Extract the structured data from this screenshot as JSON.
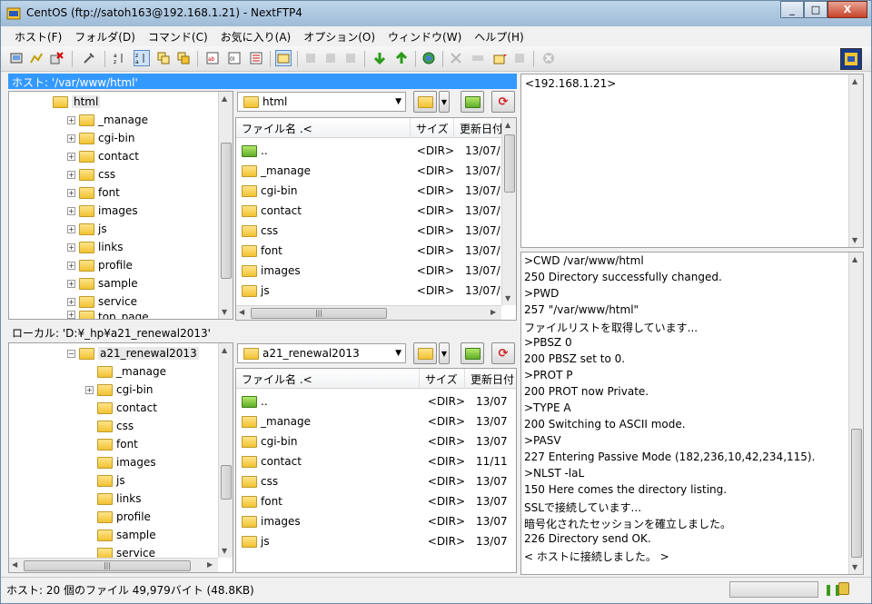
{
  "window": {
    "title": "CentOS (ftp://satoh163@192.168.1.21) - NextFTP4",
    "minimize": "_",
    "maximize": "□",
    "close": "X"
  },
  "menu": [
    "ホスト(F)",
    "フォルダ(D)",
    "コマンド(C)",
    "お気に入り(A)",
    "オプション(O)",
    "ウィンドウ(W)",
    "ヘルプ(H)"
  ],
  "toolbar": {
    "icons": [
      "connect-icon",
      "quick-connect-icon",
      "disconnect-icon",
      "properties-icon",
      "sort-asc-icon",
      "sort-desc-icon",
      "copy-view-icon",
      "sync-icon",
      "view-large-icon",
      "view-list-icon",
      "view-detail-icon",
      "open-folder-icon",
      "cut-icon",
      "copy-icon",
      "paste-icon",
      "download-icon",
      "upload-icon",
      "web-icon",
      "delete-icon",
      "rename-icon",
      "new-folder-icon",
      "attributes-icon",
      "stop-icon"
    ]
  },
  "remote": {
    "path_label": "ホスト: '/var/www/html'",
    "tree_root": "html",
    "tree_items": [
      "_manage",
      "cgi-bin",
      "contact",
      "css",
      "font",
      "images",
      "js",
      "links",
      "profile",
      "sample",
      "service",
      "top_page"
    ],
    "combo_value": "html",
    "columns": [
      "ファイル名 .<",
      "サイズ",
      "更新日付"
    ],
    "files": [
      {
        "name": "..",
        "size": "<DIR>",
        "date": "13/07/"
      },
      {
        "name": "_manage",
        "size": "<DIR>",
        "date": "13/07/"
      },
      {
        "name": "cgi-bin",
        "size": "<DIR>",
        "date": "13/07/"
      },
      {
        "name": "contact",
        "size": "<DIR>",
        "date": "13/07/"
      },
      {
        "name": "css",
        "size": "<DIR>",
        "date": "13/07/"
      },
      {
        "name": "font",
        "size": "<DIR>",
        "date": "13/07/"
      },
      {
        "name": "images",
        "size": "<DIR>",
        "date": "13/07/"
      },
      {
        "name": "js",
        "size": "<DIR>",
        "date": "13/07/"
      }
    ]
  },
  "local": {
    "path_label": "ローカル: 'D:¥_hp¥a21_renewal2013'",
    "tree_root": "a21_renewal2013",
    "tree_items": [
      "_manage",
      "cgi-bin",
      "contact",
      "css",
      "font",
      "images",
      "js",
      "links",
      "profile",
      "sample",
      "service"
    ],
    "combo_value": "a21_renewal2013",
    "columns": [
      "ファイル名 .<",
      "サイズ",
      "更新日付"
    ],
    "files": [
      {
        "name": "..",
        "size": "<DIR>",
        "date": "13/07"
      },
      {
        "name": "_manage",
        "size": "<DIR>",
        "date": "13/07"
      },
      {
        "name": "cgi-bin",
        "size": "<DIR>",
        "date": "13/07"
      },
      {
        "name": "contact",
        "size": "<DIR>",
        "date": "11/11"
      },
      {
        "name": "css",
        "size": "<DIR>",
        "date": "13/07"
      },
      {
        "name": "font",
        "size": "<DIR>",
        "date": "13/07"
      },
      {
        "name": "images",
        "size": "<DIR>",
        "date": "13/07"
      },
      {
        "name": "js",
        "size": "<DIR>",
        "date": "13/07"
      }
    ]
  },
  "info": {
    "host": "<192.168.1.21>"
  },
  "log": [
    ">CWD /var/www/html",
    "250 Directory successfully changed.",
    ">PWD",
    "257 \"/var/www/html\"",
    "ファイルリストを取得しています...",
    ">PBSZ 0",
    "200 PBSZ set to 0.",
    ">PROT P",
    "200 PROT now Private.",
    ">TYPE A",
    "200 Switching to ASCII mode.",
    ">PASV",
    "227 Entering Passive Mode (182,236,10,42,234,115).",
    ">NLST -laL",
    "150 Here comes the directory listing.",
    "SSLで接続しています...",
    "暗号化されたセッションを確立しました。",
    "226 Directory send OK.",
    "< ホストに接続しました。 >"
  ],
  "status": {
    "text": "ホスト: 20 個のファイル  49,979バイト (48.8KB)"
  }
}
